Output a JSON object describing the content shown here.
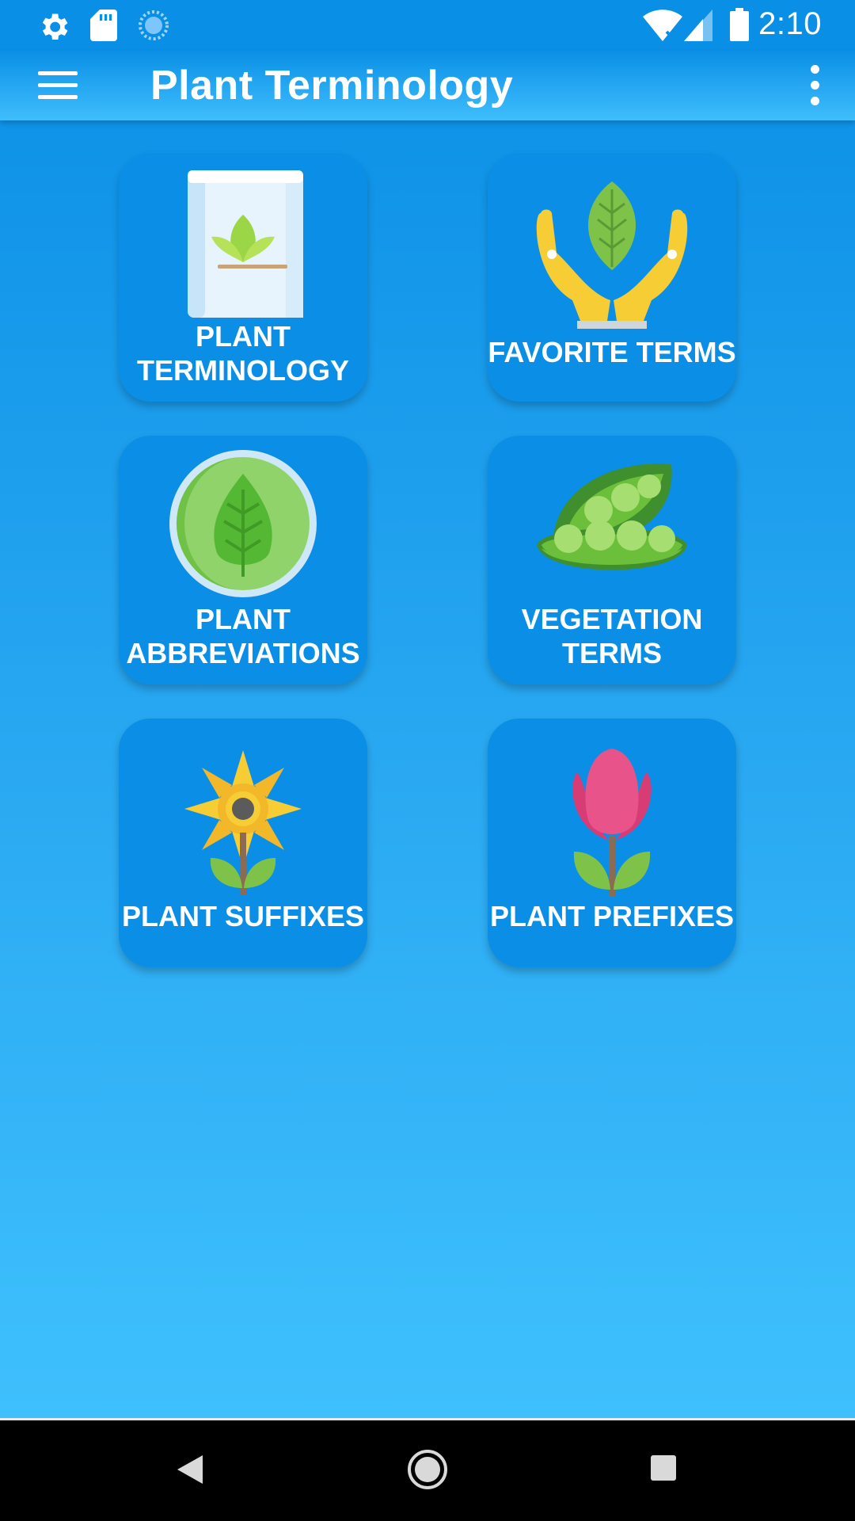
{
  "status_bar": {
    "time": "2:10",
    "left_icons": [
      "settings-icon",
      "sd-card-icon",
      "sync-icon"
    ],
    "right_icons": [
      "wifi-icon",
      "signal-icon",
      "battery-icon"
    ]
  },
  "app_bar": {
    "title": "Plant Terminology",
    "menu_icon": "hamburger-menu-icon",
    "overflow_icon": "more-vert-icon"
  },
  "tiles": [
    {
      "label": "PLANT\nTERMINOLOGY",
      "icon": "book-plant-icon"
    },
    {
      "label": "FAVORITE TERMS",
      "icon": "hands-leaf-icon"
    },
    {
      "label": "PLANT\nABBREVIATIONS",
      "icon": "leaf-badge-icon"
    },
    {
      "label": "VEGETATION\nTERMS",
      "icon": "pea-pod-icon"
    },
    {
      "label": "PLANT SUFFIXES",
      "icon": "sunflower-icon"
    },
    {
      "label": "PLANT PREFIXES",
      "icon": "tulip-icon"
    }
  ],
  "nav_bar": {
    "buttons": [
      "back-icon",
      "home-icon",
      "recents-icon"
    ]
  },
  "colors": {
    "background_top": "#0a8fe6",
    "background_bottom": "#3fc0fd",
    "tile": "#0b8ee6",
    "text": "#ffffff"
  }
}
